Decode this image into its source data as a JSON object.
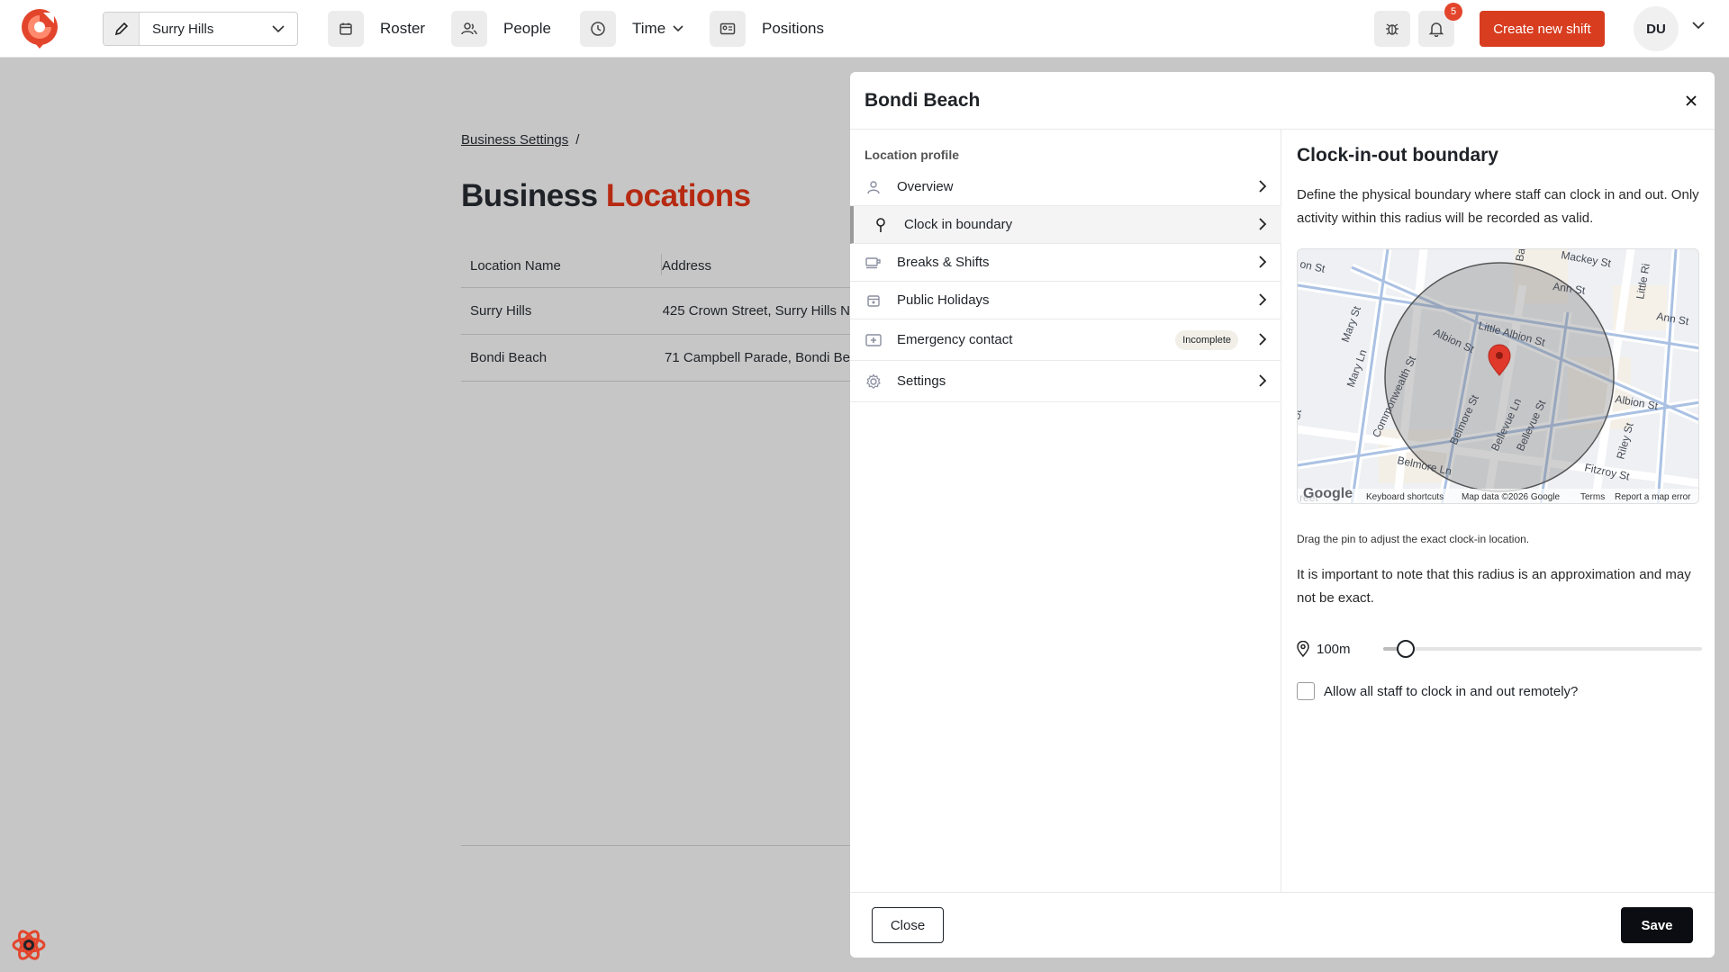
{
  "topbar": {
    "location_select": {
      "value": "Surry Hills",
      "icon": "pencil-icon"
    },
    "nav": [
      {
        "label": "Roster",
        "icon": "calendar-icon"
      },
      {
        "label": "People",
        "icon": "people-icon"
      },
      {
        "label": "Time",
        "icon": "clock-icon"
      },
      {
        "label": "Positions",
        "icon": "id-card-icon"
      }
    ],
    "notifications_count": "5",
    "create_button": "Create new shift",
    "user_initials": "DU"
  },
  "background": {
    "breadcrumb": {
      "link": "Business Settings",
      "separator": "/"
    },
    "title": {
      "part1": "Business",
      "part2": "Locations"
    },
    "table": {
      "headers": [
        "Location Name",
        "Address"
      ],
      "rows": [
        [
          "Surry Hills",
          "425 Crown Street, Surry Hills N"
        ],
        [
          "Bondi Beach",
          "71 Campbell Parade, Bondi Be"
        ]
      ]
    }
  },
  "modal": {
    "title": "Bondi Beach",
    "section_label": "Location profile",
    "menu": [
      {
        "label": "Overview",
        "icon": "person-icon"
      },
      {
        "label": "Clock in boundary",
        "icon": "map-pin-icon",
        "active": true
      },
      {
        "label": "Breaks & Shifts",
        "icon": "coffee-icon"
      },
      {
        "label": "Public Holidays",
        "icon": "calendar-icon"
      },
      {
        "label": "Emergency contact",
        "icon": "medical-icon",
        "tag": "Incomplete"
      },
      {
        "label": "Settings",
        "icon": "gear-icon"
      }
    ],
    "boundary": {
      "title": "Clock-in-out boundary",
      "description": "Define the physical boundary where staff can clock in and out. Only activity within this radius will be recorded as valid.",
      "map": {
        "streets": [
          "Mackey St",
          "Ann St",
          "Little Ri",
          "Ann St",
          "Little Albion St",
          "Albion St",
          "Albion St",
          "Mary St",
          "Mary Ln",
          "Commonwealth St",
          "Belmore St",
          "Bellevue Ln",
          "Bellevue St",
          "Belmore Ln",
          "Fitzroy St",
          "Riley St",
          "on St",
          "Batt",
          "reet",
          "St"
        ],
        "google": "Google",
        "attribution": [
          "Keyboard shortcuts",
          "Map data ©2026 Google",
          "Terms",
          "Report a map error"
        ]
      },
      "drag_note": "Drag the pin to adjust the exact clock-in location.",
      "approx_note": "It is important to note that this radius is an approximation and may not be exact.",
      "radius": {
        "label": "100m",
        "fraction": 0.07
      },
      "remote_label": "Allow all staff to clock in and out remotely?"
    },
    "footer": {
      "close": "Close",
      "save": "Save"
    }
  },
  "colors": {
    "accent": "#d83d20",
    "title_accent": "#b62a12",
    "pin": "#e0392b",
    "overlay": "#c6c6c6"
  }
}
